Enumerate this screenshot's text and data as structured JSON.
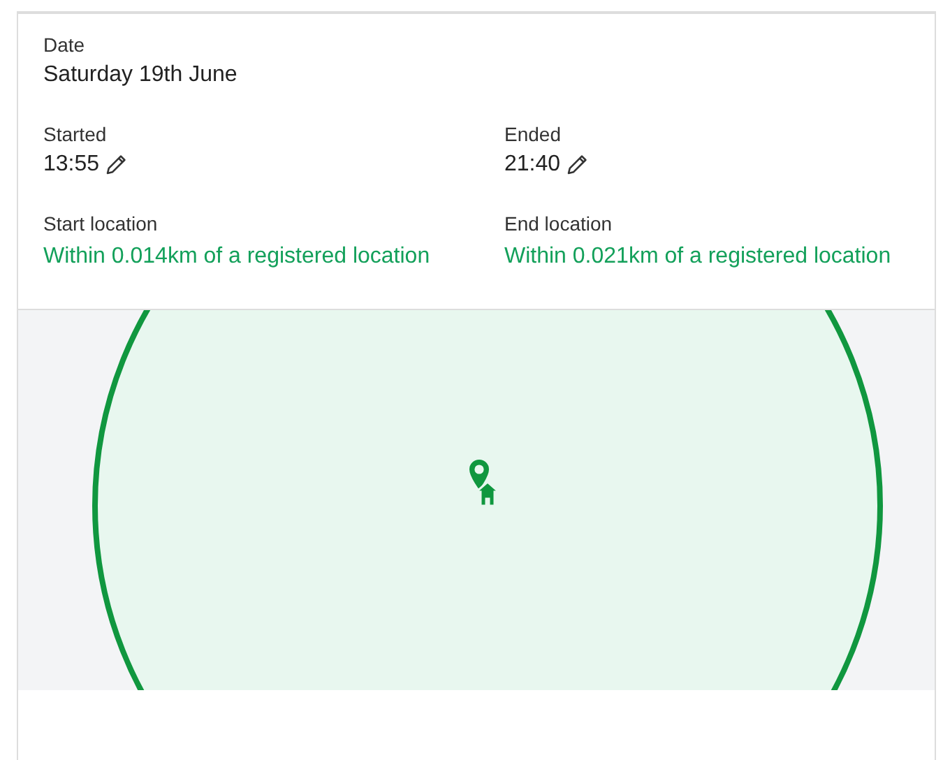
{
  "date": {
    "label": "Date",
    "value": "Saturday 19th June"
  },
  "times": [
    {
      "label": "Started",
      "value": "13:55"
    },
    {
      "label": "Ended",
      "value": "21:40"
    }
  ],
  "locations": [
    {
      "label": "Start location",
      "value": "Within 0.014km of a registered location"
    },
    {
      "label": "End location",
      "value": "Within 0.021km of a registered location"
    }
  ]
}
